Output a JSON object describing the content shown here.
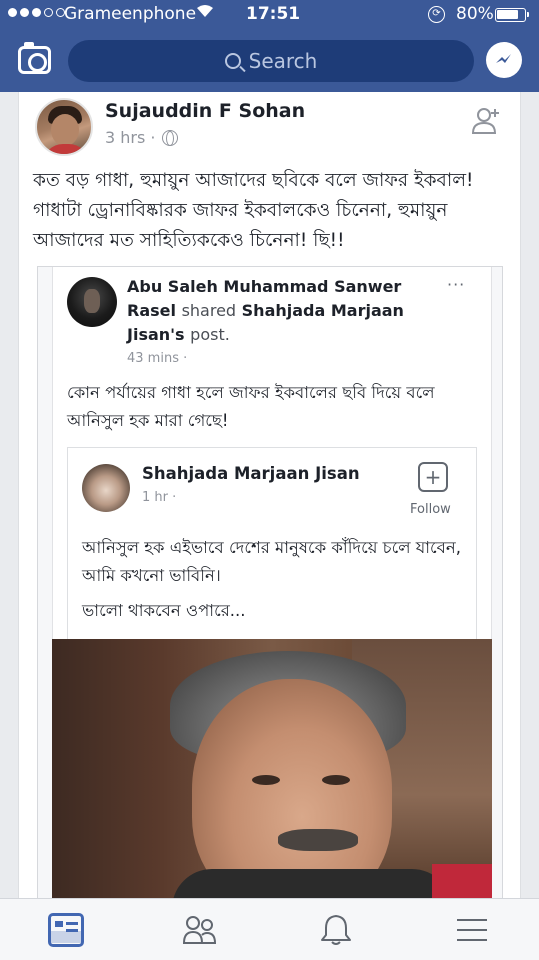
{
  "status_bar": {
    "carrier": "Grameenphone",
    "time": "17:51",
    "battery": "80%",
    "battery_level": 0.8
  },
  "nav": {
    "search_placeholder": "Search"
  },
  "post": {
    "author": "Sujauddin F Sohan",
    "time": "3 hrs ·",
    "text": "কত বড় গাধা, হুমায়ুন আজাদের ছবিকে বলে জাফর ইকবাল! গাধাটা ড্রোনাবিষ্কারক জাফর ইকবালকেও চিনেনা, হুমায়ুন আজাদের মত সাহিত্যিককেও চিনেনা! ছি!!"
  },
  "shared_screenshot": {
    "sharer_name": "Abu Saleh Muhammad Sanwer Rasel",
    "shared_word": "shared",
    "original_author": "Shahjada Marjaan Jisan's",
    "post_word": "post.",
    "more": "···",
    "time": "43 mins ·",
    "text": "কোন পর্যায়ের গাধা হলে জাফর ইকবালের ছবি দিয়ে বলে আনিসুল হক মারা গেছে!",
    "nested": {
      "author": "Shahjada Marjaan Jisan",
      "time": "1 hr ·",
      "follow_label": "Follow",
      "text": "আনিসুল হক এইভাবে দেশের মানুষকে কাঁদিয়ে চলে যাবেন, আমি কখনো ভাবিনি।",
      "text2": "ভালো থাকবেন ওপারে..."
    }
  },
  "tabs": [
    {
      "name": "news-feed",
      "active": true
    },
    {
      "name": "friends",
      "active": false
    },
    {
      "name": "notifications",
      "active": false
    },
    {
      "name": "menu",
      "active": false
    }
  ],
  "colors": {
    "brand": "#3b5998",
    "active_tab": "#4267b2",
    "secondary_text": "#90949c"
  }
}
